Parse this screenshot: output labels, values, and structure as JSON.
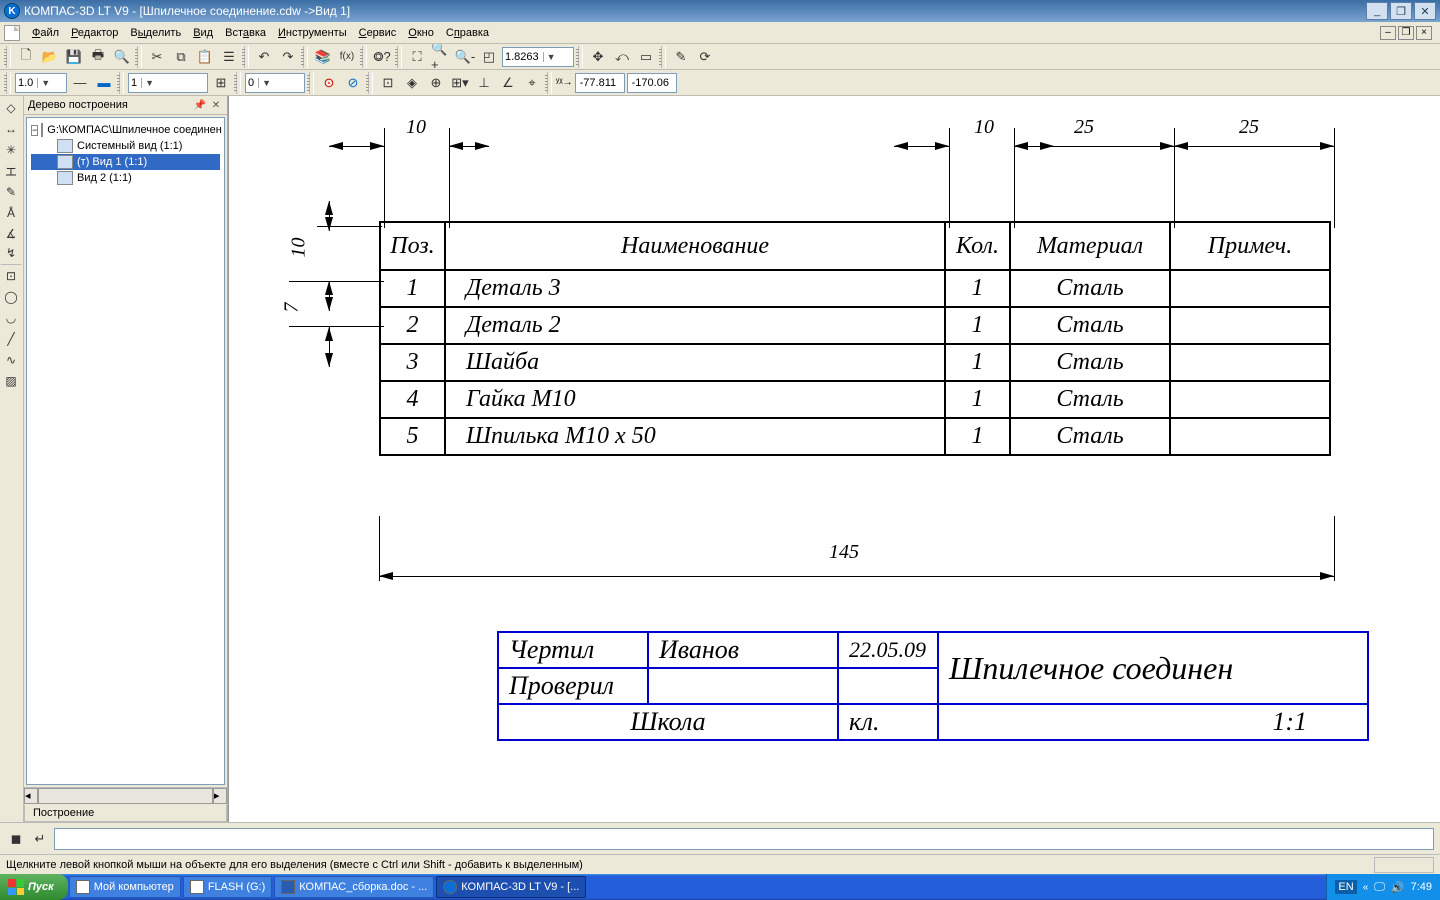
{
  "title": "КОМПАС-3D LT V9 - [Шпилечное соединение.cdw ->Вид 1]",
  "appicon_letter": "K",
  "menu": {
    "file": "Файл",
    "edit": "Редактор",
    "select": "Выделить",
    "view": "Вид",
    "insert": "Вставка",
    "tools": "Инструменты",
    "service": "Сервис",
    "window": "Окно",
    "help": "Справка"
  },
  "zoom_combo": "1.8263",
  "coord_x": "-77.811",
  "coord_y": "-170.06",
  "style_combo1": "1.0",
  "style_combo2": "1",
  "style_combo3": "0",
  "tree": {
    "title": "Дерево построения",
    "root": "G:\\КОМПАС\\Шпилечное соединен",
    "n1": "Системный вид (1:1)",
    "n2": "(т) Вид 1 (1:1)",
    "n3": "Вид 2 (1:1)",
    "tab": "Построение"
  },
  "dims": {
    "d10a": "10",
    "d10b": "10",
    "d25a": "25",
    "d25b": "25",
    "d10v": "10",
    "d7v": "7",
    "d145": "145"
  },
  "spec": {
    "hdr": {
      "pos": "Поз.",
      "name": "Наименование",
      "qty": "Кол.",
      "mat": "Материал",
      "note": "Примеч."
    },
    "rows": [
      {
        "pos": "1",
        "name": "Деталь 3",
        "qty": "1",
        "mat": "Сталь",
        "note": ""
      },
      {
        "pos": "2",
        "name": "Деталь 2",
        "qty": "1",
        "mat": "Сталь",
        "note": ""
      },
      {
        "pos": "3",
        "name": "Шайба",
        "qty": "1",
        "mat": "Сталь",
        "note": ""
      },
      {
        "pos": "4",
        "name": "Гайка М10",
        "qty": "1",
        "mat": "Сталь",
        "note": ""
      },
      {
        "pos": "5",
        "name": "Шпилька М10 х 50",
        "qty": "1",
        "mat": "Сталь",
        "note": ""
      }
    ]
  },
  "stamp": {
    "drew": "Чертил",
    "drew_name": "Иванов",
    "drew_date": "22.05.09",
    "checked": "Проверил",
    "title": "Шпилечное соединен",
    "school": "Школа",
    "class": "кл.",
    "scale": "1:1"
  },
  "status": "Щелкните левой кнопкой мыши на объекте для его выделения (вместе с Ctrl или Shift - добавить к выделенным)",
  "taskbar": {
    "start": "Пуск",
    "items": [
      "Мой компьютер",
      "FLASH (G:)",
      "КОМПАС_сборка.doc - ...",
      "КОМПАС-3D LT V9 - [..."
    ],
    "lang": "EN",
    "time": "7:49"
  }
}
